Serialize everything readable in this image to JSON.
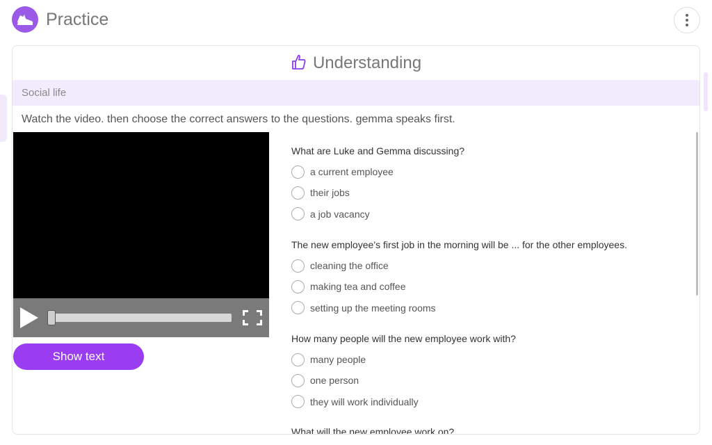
{
  "app": {
    "title": "Practice",
    "logo_icon": "sneaker-icon",
    "more_icon": "more-vertical-icon",
    "accent_color": "#9a3cf2"
  },
  "card": {
    "title": "Understanding",
    "title_icon": "thumbs-up-icon",
    "category": "Social life",
    "instructions": "Watch the video. then choose the correct answers to the questions. gemma speaks first."
  },
  "video": {
    "progress": 0
  },
  "show_text_button": "Show text",
  "questions": [
    {
      "text": "What are Luke and Gemma discussing?",
      "options": [
        "a current employee",
        "their jobs",
        "a job vacancy"
      ]
    },
    {
      "text": "The new employee’s first job in the morning will be ... for the other employees.",
      "options": [
        "cleaning the office",
        "making tea and coffee",
        "setting up the meeting rooms"
      ]
    },
    {
      "text": "How many people will the new employee work with?",
      "options": [
        "many people",
        "one person",
        "they will work individually"
      ]
    },
    {
      "text": "What will the new employee work on?",
      "options": []
    }
  ]
}
